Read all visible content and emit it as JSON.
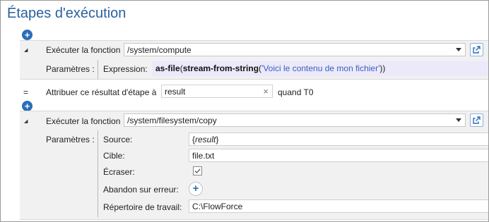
{
  "page": {
    "title": "Étapes d'exécution"
  },
  "step1": {
    "label": "Exécuter la fonction",
    "function_value": "/system/compute",
    "params_label": "Paramètres :",
    "expression_label": "Expression:",
    "expression": {
      "fn1": "as-file",
      "p1": "(",
      "fn2": "stream-from-string",
      "p2": "(",
      "str": "'Voici le contenu de mon fichier'",
      "p3": "))"
    }
  },
  "assign": {
    "symbol": "=",
    "label": "Attribuer ce résultat d'étape à",
    "value": "result",
    "clear": "×",
    "suffix": "quand T0"
  },
  "step2": {
    "label": "Exécuter la fonction",
    "function_value": "/system/filesystem/copy",
    "params_label": "Paramètres :",
    "source_label": "Source:",
    "source": {
      "open": "{",
      "var": "result",
      "close": "}"
    },
    "cible_label": "Cible:",
    "cible_value": "file.txt",
    "ecraser_label": "Écraser:",
    "ecraser_checked": true,
    "abandon_label": "Abandon sur erreur:",
    "repertoire_label": "Répertoire de travail:",
    "repertoire_value": "C:\\FlowForce"
  },
  "icons": {
    "add": "+",
    "check": "✓"
  },
  "colors": {
    "accent": "#2a6eb8",
    "title": "#2a5f9e",
    "expression_bg": "#ece9fb"
  }
}
